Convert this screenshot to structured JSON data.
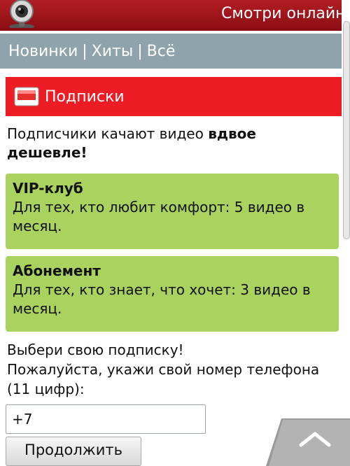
{
  "header": {
    "title": "Смотри онлайн",
    "logo_icon": "webcam-icon",
    "bar_color": "#a3141b"
  },
  "nav": {
    "items": [
      "Новинки",
      "Хиты",
      "Всё"
    ],
    "separator": "|",
    "background": "#8fa3ad"
  },
  "section": {
    "icon": "tv-icon",
    "title": "Подписки",
    "background": "#ee1c24"
  },
  "intro": {
    "text": "Подписчики качают видео ",
    "bold": "вдвое дешевле!"
  },
  "plans": [
    {
      "title": "VIP-клуб",
      "description": "Для тех, кто любит комфорт: 5 видео в месяц."
    },
    {
      "title": "Абонемент",
      "description": "Для тех, кто знает, что хочет: 3 видео в месяц."
    }
  ],
  "plan_color": "#a9d25e",
  "form": {
    "choose_text": "Выбери свою подписку!",
    "phone_prompt": "Пожалуйста, укажи свой номер телефона (11 цифр):",
    "phone_value": "+7",
    "continue_label": "Продолжить"
  },
  "scroll_top_icon": "chevron-up-icon"
}
